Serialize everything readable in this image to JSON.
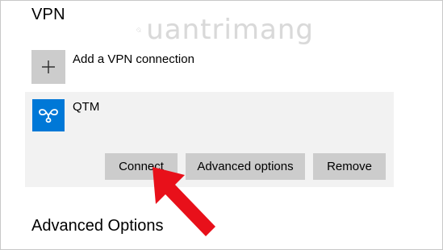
{
  "vpn": {
    "title": "VPN",
    "add_connection_label": "Add a VPN connection",
    "connection": {
      "name": "QTM",
      "buttons": {
        "connect": "Connect",
        "advanced_options": "Advanced options",
        "remove": "Remove"
      }
    }
  },
  "advanced_section_title": "Advanced Options",
  "watermark": {
    "text": "uantrimang"
  },
  "colors": {
    "accent": "#0078d7",
    "button": "#cccccc",
    "card": "#f2f2f2",
    "arrow": "#e8101a"
  },
  "icons": [
    "plus-icon",
    "vpn-icon",
    "watermark-logo-icon",
    "red-arrow-annotation"
  ]
}
